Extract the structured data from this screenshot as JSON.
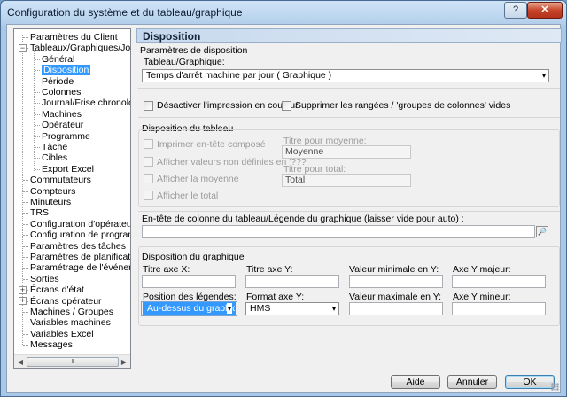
{
  "window": {
    "title": "Configuration du système et du tableau/graphique",
    "help_label": "?",
    "close_label": "✕"
  },
  "tree": {
    "items": [
      {
        "label": "Paramètres du Client"
      },
      {
        "label": "Tableaux/Graphiques/Journa"
      },
      {
        "label": "Général"
      },
      {
        "label": "Disposition",
        "selected": true
      },
      {
        "label": "Période"
      },
      {
        "label": "Colonnes"
      },
      {
        "label": "Journal/Frise chronologic"
      },
      {
        "label": "Machines"
      },
      {
        "label": "Opérateur"
      },
      {
        "label": "Programme"
      },
      {
        "label": "Tâche"
      },
      {
        "label": "Cibles"
      },
      {
        "label": "Export Excel"
      },
      {
        "label": "Commutateurs"
      },
      {
        "label": "Compteurs"
      },
      {
        "label": "Minuteurs"
      },
      {
        "label": "TRS"
      },
      {
        "label": "Configuration d'opérateur"
      },
      {
        "label": "Configuration de programme"
      },
      {
        "label": "Paramètres des tâches"
      },
      {
        "label": "Paramètres de planification"
      },
      {
        "label": "Paramétrage de l'événement"
      },
      {
        "label": "Sorties"
      },
      {
        "label": "Écrans d'état"
      },
      {
        "label": "Écrans opérateur"
      },
      {
        "label": "Machines / Groupes"
      },
      {
        "label": "Variables machines"
      },
      {
        "label": "Variables Excel"
      },
      {
        "label": "Messages"
      }
    ],
    "scroll_left": "◀",
    "scroll_right": "▶",
    "scroll_grip": "III"
  },
  "panel": {
    "title": "Disposition",
    "layout_params": {
      "heading": "Paramètres de disposition",
      "chart_label": "Tableau/Graphique:",
      "chart_value": "Temps d'arrêt machine par jour  ( Graphique )"
    },
    "options": {
      "disable_color_print": "Désactiver l'impression en couleur",
      "remove_empty_rows": "Supprimer les rangées / 'groupes de colonnes' vides"
    },
    "table_layout": {
      "heading": "Disposition du tableau",
      "print_composite_header": "Imprimer en-tête composé",
      "show_undefined": "Afficher valeurs non définies en '???",
      "show_average": "Afficher la moyenne",
      "show_total": "Afficher le total",
      "avg_title_label": "Titre pour moyenne:",
      "avg_title_value": "Moyenne",
      "total_title_label": "Titre pour total:",
      "total_title_value": "Total"
    },
    "column_header": {
      "label": "En-tête de colonne du tableau/Légende du graphique (laisser vide pour auto) :",
      "value": ""
    },
    "chart_layout": {
      "heading": "Disposition du graphique",
      "x_axis_title": "Titre axe X:",
      "y_axis_title": "Titre axe Y:",
      "min_y": "Valeur minimale en Y:",
      "major_y": "Axe Y majeur:",
      "legend_pos_label": "Position des légendes:",
      "legend_pos_value": "Au-dessus du graphique",
      "y_format_label": "Format axe Y:",
      "y_format_value": "HMS",
      "max_y": "Valeur maximale en Y:",
      "minor_y": "Axe Y mineur:"
    }
  },
  "buttons": {
    "help": "Aide",
    "cancel": "Annuler",
    "ok": "OK"
  },
  "icons": {
    "dropdown": "▾",
    "browse": "🔎"
  }
}
